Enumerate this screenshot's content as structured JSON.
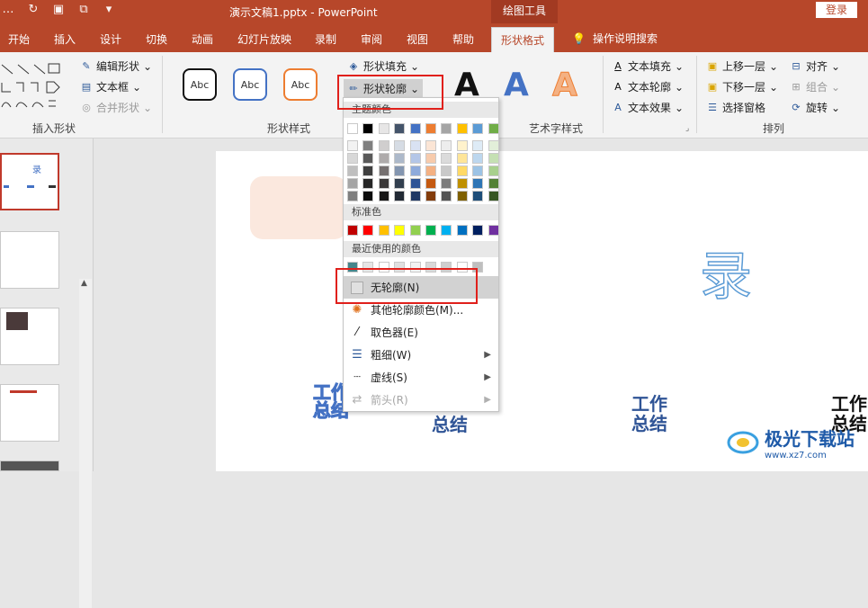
{
  "title_bar": {
    "doc_title": "演示文稿1.pptx  -  PowerPoint",
    "context_tools": "绘图工具",
    "login": "登录"
  },
  "tabs": [
    "开始",
    "插入",
    "设计",
    "切换",
    "动画",
    "幻灯片放映",
    "录制",
    "审阅",
    "视图",
    "帮助",
    "形状格式"
  ],
  "active_tab": "形状格式",
  "tell_me": "操作说明搜索",
  "ribbon": {
    "insert_shapes": {
      "label": "插入形状",
      "edit_shape": "编辑形状",
      "text_box": "文本框",
      "merge_shapes": "合并形状"
    },
    "shape_styles": {
      "label": "形状样式",
      "samples": [
        "Abc",
        "Abc",
        "Abc"
      ],
      "fill": "形状填充",
      "outline": "形状轮廓"
    },
    "wordart": {
      "label": "艺术字样式",
      "text_fill": "文本填充",
      "text_outline": "文本轮廓",
      "text_effects": "文本效果",
      "sample": "A"
    },
    "arrange": {
      "label": "排列",
      "bring_forward": "上移一层",
      "send_backward": "下移一层",
      "selection_pane": "选择窗格",
      "align": "对齐",
      "group": "组合",
      "rotate": "旋转"
    }
  },
  "dropdown": {
    "theme_colors_label": "主题颜色",
    "theme_top": [
      "#ffffff",
      "#000000",
      "#e7e6e6",
      "#44546a",
      "#4472c4",
      "#ed7d31",
      "#a5a5a5",
      "#ffc000",
      "#5b9bd5",
      "#70ad47"
    ],
    "theme_shades": [
      [
        "#f2f2f2",
        "#7f7f7f",
        "#d0cece",
        "#d6dce4",
        "#d9e2f3",
        "#fbe5d5",
        "#ededed",
        "#fff2cc",
        "#deebf6",
        "#e2efd9"
      ],
      [
        "#d8d8d8",
        "#595959",
        "#aeabab",
        "#adb9ca",
        "#b4c6e7",
        "#f7cbac",
        "#dbdbdb",
        "#fee599",
        "#bdd7ee",
        "#c5e0b3"
      ],
      [
        "#bfbfbf",
        "#3f3f3f",
        "#757070",
        "#8496b0",
        "#8eaadb",
        "#f4b183",
        "#c9c9c9",
        "#ffd965",
        "#9cc3e5",
        "#a8d08d"
      ],
      [
        "#a5a5a5",
        "#262626",
        "#3a3838",
        "#323f4f",
        "#2f5496",
        "#c55a11",
        "#7b7b7b",
        "#bf9000",
        "#2e75b5",
        "#538135"
      ],
      [
        "#7f7f7f",
        "#0c0c0c",
        "#171616",
        "#222a35",
        "#1f3864",
        "#833c0b",
        "#525252",
        "#7f6000",
        "#1e4e79",
        "#375623"
      ]
    ],
    "standard_label": "标准色",
    "standard": [
      "#c00000",
      "#ff0000",
      "#ffc000",
      "#ffff00",
      "#92d050",
      "#00b050",
      "#00b0f0",
      "#0070c0",
      "#002060",
      "#7030a0"
    ],
    "recent_label": "最近使用的颜色",
    "recent": [
      "#44868c",
      "#e6e6e6",
      "#ffffff",
      "#e0e0e0",
      "#f2f2f2",
      "#d9d9d9",
      "#cfcfcf",
      "#ffffff",
      "#bfbfbf"
    ],
    "items": {
      "no_outline": "无轮廓(N)",
      "more_colors": "其他轮廓颜色(M)...",
      "eyedropper": "取色器(E)",
      "weight": "粗细(W)",
      "dashes": "虚线(S)",
      "arrows": "箭头(R)"
    }
  },
  "slide": {
    "big_char": "录",
    "word1": "工作",
    "word2": "总结",
    "thumb_char": "录"
  },
  "watermark": {
    "text": "极光下载站",
    "url": "www.xz7.com"
  }
}
